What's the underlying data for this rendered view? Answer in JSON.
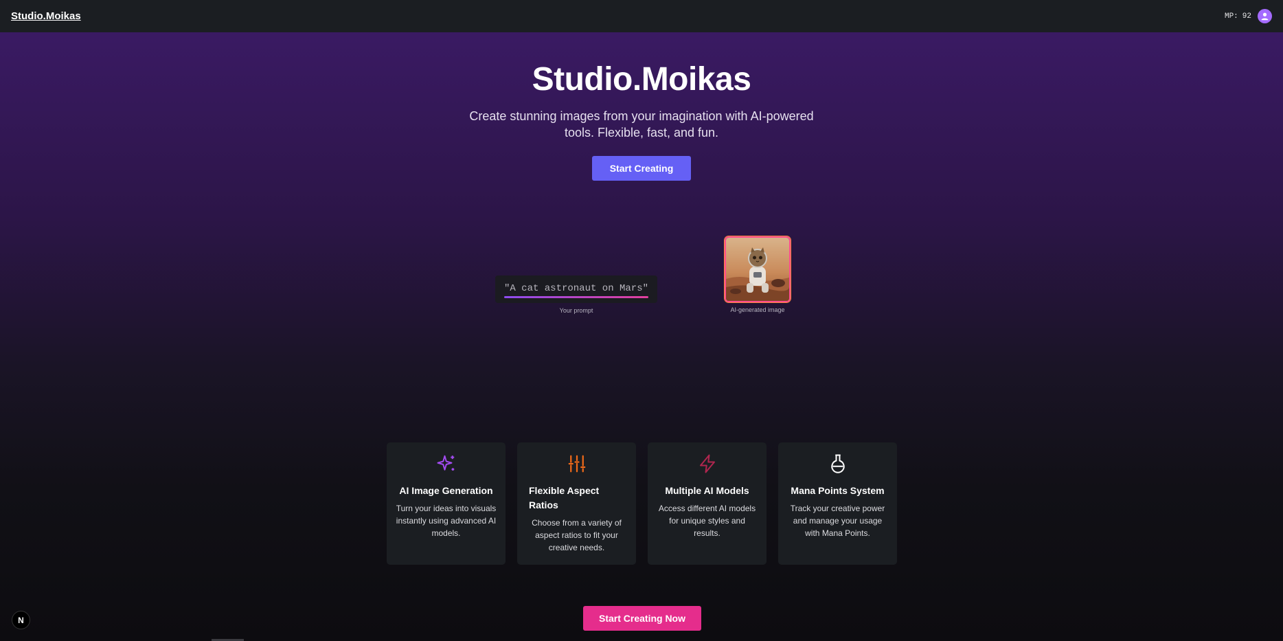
{
  "header": {
    "brand": "Studio.Moikas",
    "mana_label": "MP:",
    "mana_value": "92",
    "avatar_icon": "user-icon"
  },
  "hero": {
    "title": "Studio.Moikas",
    "subtitle": "Create stunning images from your imagination with AI-powered tools. Flexible, fast, and fun.",
    "cta_label": "Start Creating"
  },
  "demo": {
    "prompt_text": "\"A cat astronaut on Mars\"",
    "prompt_caption": "Your prompt",
    "image_caption": "AI-generated image",
    "image_subject": "cat astronaut on Mars"
  },
  "features": [
    {
      "icon": "sparkles-icon",
      "color": "#a24bf0",
      "title": "AI Image Generation",
      "description": "Turn your ideas into visuals instantly using advanced AI models."
    },
    {
      "icon": "sliders-icon",
      "color": "#f06a1a",
      "title": "Flexible Aspect Ratios",
      "description": "Choose from a variety of aspect ratios to fit your creative needs."
    },
    {
      "icon": "lightning-icon",
      "color": "#b0264f",
      "title": "Multiple AI Models",
      "description": "Access different AI models for unique styles and results."
    },
    {
      "icon": "flask-icon",
      "color": "#ffffff",
      "title": "Mana Points System",
      "description": "Track your creative power and manage your usage with Mana Points."
    }
  ],
  "footer_cta": {
    "label": "Start Creating Now"
  },
  "dev_badge": {
    "label": "N"
  },
  "colors": {
    "primary_button": "#6560f5",
    "pink_button": "#e52d8c",
    "topbar": "#1b1e22",
    "card": "#1b1e22"
  }
}
